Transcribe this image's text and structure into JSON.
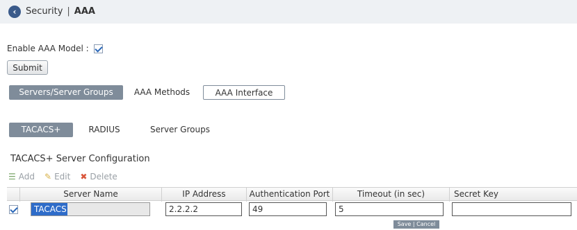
{
  "header": {
    "section": "Security",
    "separator": "|",
    "current": "AAA"
  },
  "enable_aaa": {
    "label": "Enable AAA Model :",
    "checked": true
  },
  "submit_label": "Submit",
  "main_tabs": [
    {
      "label": "Servers/Server Groups",
      "active": true
    },
    {
      "label": "AAA Methods",
      "active": false
    },
    {
      "label": "AAA Interface",
      "active": false
    }
  ],
  "sub_tabs": [
    {
      "label": "TACACS+",
      "active": true
    },
    {
      "label": "RADIUS",
      "active": false
    },
    {
      "label": "Server Groups",
      "active": false
    }
  ],
  "section_title": "TACACS+ Server Configuration",
  "toolbar": {
    "add": "Add",
    "edit": "Edit",
    "delete": "Delete"
  },
  "table": {
    "columns": [
      "Server Name",
      "IP Address",
      "Authentication Port",
      "Timeout (in sec)",
      "Secret Key"
    ],
    "row": {
      "checked": true,
      "server_name": "TACACS",
      "ip_address": "2.2.2.2",
      "auth_port": "49",
      "timeout": "5",
      "secret_key": ""
    }
  },
  "row_actions": {
    "save": "Save",
    "separator": "|",
    "cancel": "Cancel"
  },
  "colors": {
    "active_tab": "#7f8c9a",
    "selection": "#2e6cc9",
    "back_button": "#3a5a8a",
    "topbar": "#eef1f4"
  }
}
